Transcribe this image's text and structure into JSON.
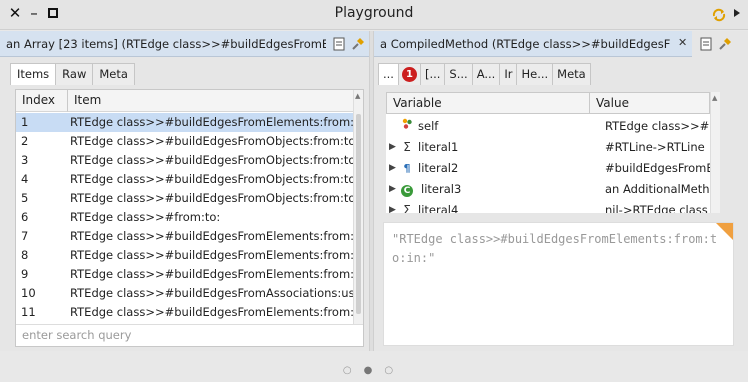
{
  "window": {
    "title": "Playground",
    "close_symbol": "✕",
    "minimize_symbol": "–",
    "maximize_symbol": "□"
  },
  "left_pane": {
    "title": "an Array [23 items] (RTEdge class>>#buildEdgesFromEle...",
    "tabs": [
      "Items",
      "Raw",
      "Meta"
    ],
    "active_tab": "Items",
    "columns": [
      "Index",
      "Item"
    ],
    "rows": [
      {
        "index": "1",
        "item": "RTEdge class>>#buildEdgesFromElements:from:to:"
      },
      {
        "index": "2",
        "item": "RTEdge class>>#buildEdgesFromObjects:from:toAll"
      },
      {
        "index": "3",
        "item": "RTEdge class>>#buildEdgesFromObjects:from:toAll"
      },
      {
        "index": "4",
        "item": "RTEdge class>>#buildEdgesFromObjects:from:toAll"
      },
      {
        "index": "5",
        "item": "RTEdge class>>#buildEdgesFromObjects:from:to:us"
      },
      {
        "index": "6",
        "item": "RTEdge class>>#from:to:"
      },
      {
        "index": "7",
        "item": "RTEdge class>>#buildEdgesFromElements:from:to:"
      },
      {
        "index": "8",
        "item": "RTEdge class>>#buildEdgesFromElements:from:toA"
      },
      {
        "index": "9",
        "item": "RTEdge class>>#buildEdgesFromElements:from:toA"
      },
      {
        "index": "10",
        "item": "RTEdge class>>#buildEdgesFromAssociations:using"
      },
      {
        "index": "11",
        "item": "RTEdge class>>#buildEdgesFromElements:from:toA"
      }
    ],
    "selected_index": "1",
    "search_placeholder": "enter search query"
  },
  "right_pane": {
    "title": "a CompiledMethod (RTEdge class>>#buildEdgesFro...",
    "close_symbol": "✕",
    "tabs": [
      "...",
      "[...",
      "S...",
      "A...",
      "Ir",
      "He...",
      "Meta"
    ],
    "badge_count": "1",
    "columns": [
      "Variable",
      "Value"
    ],
    "variables": [
      {
        "name": "self",
        "value": "RTEdge class>>#bui",
        "icon": "object-icon",
        "expandable": false
      },
      {
        "name": "literal1",
        "value": "#RTLine->RTLine",
        "icon": "sigma-icon",
        "expandable": true
      },
      {
        "name": "literal2",
        "value": "#buildEdgesFromEle",
        "icon": "pilcrow-icon",
        "expandable": true
      },
      {
        "name": "literal3",
        "value": "an AdditionalMetho",
        "icon": "class-icon",
        "expandable": true
      },
      {
        "name": "literal4",
        "value": "nil->RTEdge class",
        "icon": "sigma-icon",
        "expandable": true
      }
    ],
    "code": "\"RTEdge class>>#buildEdgesFromElements:from:to:in:\""
  },
  "colors": {
    "selection": "#c8dcf4",
    "tab_header": "#d6e2f0",
    "badge": "#cc1f1f",
    "corner": "#f0a040"
  }
}
